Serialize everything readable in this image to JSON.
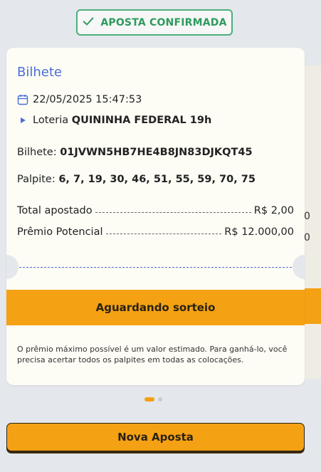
{
  "badge": {
    "label": "APOSTA CONFIRMADA",
    "icon": "check-icon",
    "color": "#2e9a5e"
  },
  "back_card": {
    "peek_values": [
      "0",
      "0"
    ]
  },
  "ticket": {
    "title": "Bilhete",
    "datetime": "22/05/2025 15:47:53",
    "lottery_prefix": "Loteria",
    "lottery_name": "QUININHA FEDERAL 19h",
    "ticket_label": "Bilhete:",
    "ticket_code": "01JVWN5HB7HE4B8JN83DJKQT45",
    "guess_label": "Palpite:",
    "guess_values": "6, 7, 19, 30, 46, 51, 55, 59, 70, 75",
    "total_label": "Total apostado",
    "total_value": "R$ 2,00",
    "prize_label": "Prêmio Potencial",
    "prize_value": "R$ 12.000,00",
    "status": "Aguardando sorteio",
    "note": "O prêmio máximo possível é um valor estimado. Para ganhá-lo, você precisa acertar todos os palpites em todas as colocações."
  },
  "pager": {
    "current": 1,
    "total": 2
  },
  "actions": {
    "new_bet_label": "Nova Aposta"
  },
  "colors": {
    "accent": "#f5a114",
    "title_blue": "#4a6fd6",
    "success": "#2e9a5e"
  }
}
